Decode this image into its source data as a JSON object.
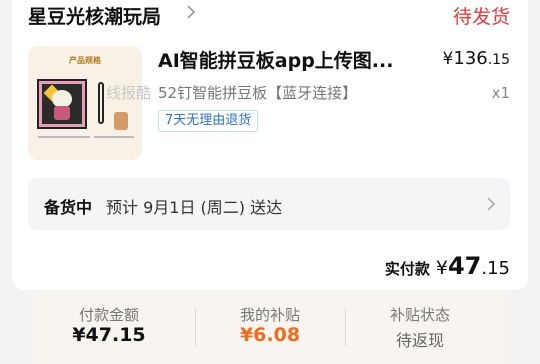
{
  "store": {
    "name": "星豆光核潮玩局",
    "status": "待发货"
  },
  "product": {
    "thumb_title": "产品规格",
    "title": "AI智能拼豆板app上传图...",
    "price_currency": "¥",
    "price_int": "136",
    "price_dec": ".15",
    "spec": "52钉智能拼豆板【蓝牙连接】",
    "watermark": "线报酷",
    "qty": "x1",
    "tag": "7天无理由退货"
  },
  "shipping": {
    "status": "备货中",
    "text": "预计 9月1日 (周二) 送达"
  },
  "payment": {
    "label": "实付款",
    "currency": "¥",
    "int": "47",
    "dec": ".15"
  },
  "summary": [
    {
      "label": "付款金额",
      "value": "¥47.15"
    },
    {
      "label": "我的补贴",
      "value": "¥6.08"
    },
    {
      "label": "补贴状态",
      "value": "待返现"
    }
  ],
  "colors": {
    "status_red": "#e8383d",
    "subsidy_orange": "#f26a1b",
    "tag_blue": "#2e6fd8"
  },
  "icons": [
    "chevron-right-icon"
  ]
}
